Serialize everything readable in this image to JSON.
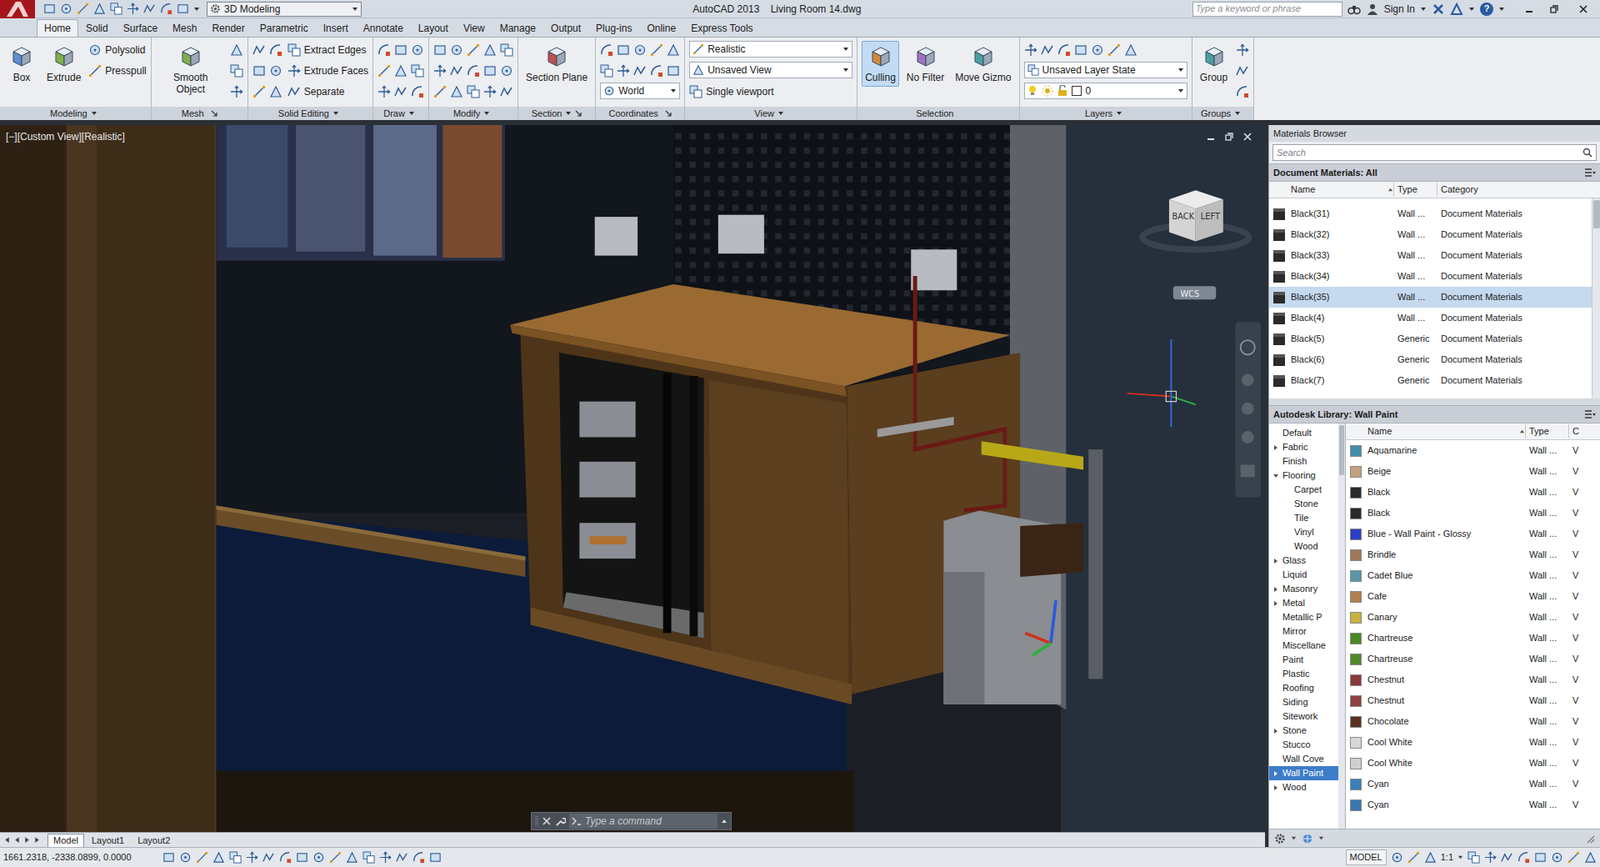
{
  "title_bar": {
    "workspace": "3D Modeling",
    "title": "AutoCAD 2013    Living Room 14.dwg",
    "search_placeholder": "Type a keyword or phrase",
    "sign_in": "Sign In",
    "help": "?"
  },
  "ribbon": {
    "tabs": [
      {
        "label": "Home",
        "selected": true
      },
      {
        "label": "Solid",
        "selected": false
      },
      {
        "label": "Surface",
        "selected": false
      },
      {
        "label": "Mesh",
        "selected": false
      },
      {
        "label": "Render",
        "selected": false
      },
      {
        "label": "Parametric",
        "selected": false
      },
      {
        "label": "Insert",
        "selected": false
      },
      {
        "label": "Annotate",
        "selected": false
      },
      {
        "label": "Layout",
        "selected": false
      },
      {
        "label": "View",
        "selected": false
      },
      {
        "label": "Manage",
        "selected": false
      },
      {
        "label": "Output",
        "selected": false
      },
      {
        "label": "Plug-ins",
        "selected": false
      },
      {
        "label": "Online",
        "selected": false
      },
      {
        "label": "Express Tools",
        "selected": false
      }
    ],
    "panels": [
      {
        "title": "Modeling",
        "menu": true,
        "launcher": false,
        "tools": [
          {
            "kind": "large",
            "label": "Box"
          },
          {
            "kind": "large",
            "label": "Extrude"
          },
          {
            "kind": "small",
            "label": "Polysolid"
          },
          {
            "kind": "small",
            "label": "Presspull"
          }
        ]
      },
      {
        "title": "Mesh",
        "menu": false,
        "launcher": true,
        "tools": [
          {
            "kind": "large",
            "label": "Smooth Object"
          },
          {
            "kind": "strip",
            "icons": 1
          },
          {
            "kind": "strip",
            "icons": 1
          },
          {
            "kind": "strip",
            "icons": 1
          }
        ]
      },
      {
        "title": "Solid Editing",
        "menu": true,
        "launcher": false,
        "tools": [
          {
            "kind": "strip",
            "icons": 2
          },
          {
            "kind": "strip",
            "icons": 2
          },
          {
            "kind": "strip",
            "icons": 2
          },
          {
            "kind": "small",
            "label": "Extract Edges"
          },
          {
            "kind": "small",
            "label": "Extrude Faces"
          },
          {
            "kind": "small",
            "label": "Separate"
          }
        ]
      },
      {
        "title": "Draw",
        "menu": true,
        "launcher": false,
        "tools": [
          {
            "kind": "strip",
            "icons": 3
          },
          {
            "kind": "strip",
            "icons": 3
          },
          {
            "kind": "strip",
            "icons": 3
          }
        ]
      },
      {
        "title": "Modify",
        "menu": true,
        "launcher": false,
        "tools": [
          {
            "kind": "strip",
            "icons": 5
          },
          {
            "kind": "strip",
            "icons": 5
          },
          {
            "kind": "strip",
            "icons": 5
          }
        ]
      },
      {
        "title": "Section",
        "menu": true,
        "launcher": true,
        "tools": [
          {
            "kind": "large",
            "label": "Section Plane"
          }
        ]
      },
      {
        "title": "Coordinates",
        "menu": false,
        "launcher": true,
        "tools": [
          {
            "kind": "strip",
            "icons": 5
          },
          {
            "kind": "strip",
            "icons": 5
          },
          {
            "kind": "dropdown",
            "label": "World"
          }
        ]
      },
      {
        "title": "View",
        "menu": true,
        "launcher": false,
        "tools": [
          {
            "kind": "dropdown",
            "label": "Realistic"
          },
          {
            "kind": "dropdown",
            "label": "Unsaved View"
          },
          {
            "kind": "small",
            "label": "Single viewport"
          }
        ]
      },
      {
        "title": "Selection",
        "menu": false,
        "launcher": false,
        "tools": [
          {
            "kind": "toggle",
            "label": "Culling",
            "on": true
          },
          {
            "kind": "large",
            "label": "No Filter"
          },
          {
            "kind": "large",
            "label": "Move Gizmo"
          }
        ]
      },
      {
        "title": "Layers",
        "menu": true,
        "launcher": false,
        "tools": [
          {
            "kind": "strip",
            "icons": 7
          },
          {
            "kind": "dropdown",
            "label": "Unsaved Layer State"
          },
          {
            "kind": "layer",
            "label": "0"
          }
        ]
      },
      {
        "title": "Groups",
        "menu": true,
        "launcher": false,
        "tools": [
          {
            "kind": "large",
            "label": "Group"
          },
          {
            "kind": "strip",
            "icons": 1
          },
          {
            "kind": "strip",
            "icons": 1
          },
          {
            "kind": "strip",
            "icons": 1
          }
        ]
      }
    ]
  },
  "viewport": {
    "label": "[−][Custom View][Realistic]",
    "viewcube": {
      "back": "BACK",
      "left": "LEFT",
      "wcs": "WCS"
    },
    "command_placeholder": "Type a command"
  },
  "layout_tabs": [
    {
      "label": "Model",
      "selected": true
    },
    {
      "label": "Layout1",
      "selected": false
    },
    {
      "label": "Layout2",
      "selected": false
    }
  ],
  "status_bar": {
    "coordinates": "1661.2318, -2338.0899, 0.0000",
    "space": "MODEL",
    "scale": "1:1"
  },
  "materials_browser": {
    "title": "Materials Browser",
    "search_placeholder": "Search",
    "doc_header": "Document Materials: All",
    "doc_columns": [
      "Name",
      "Type",
      "Category"
    ],
    "doc_rows": [
      {
        "name": "Black(31)",
        "type": "Wall ...",
        "category": "Document Materials",
        "selected": false
      },
      {
        "name": "Black(32)",
        "type": "Wall ...",
        "category": "Document Materials",
        "selected": false
      },
      {
        "name": "Black(33)",
        "type": "Wall ...",
        "category": "Document Materials",
        "selected": false
      },
      {
        "name": "Black(34)",
        "type": "Wall ...",
        "category": "Document Materials",
        "selected": false
      },
      {
        "name": "Black(35)",
        "type": "Wall ...",
        "category": "Document Materials",
        "selected": true
      },
      {
        "name": "Black(4)",
        "type": "Wall ...",
        "category": "Document Materials",
        "selected": false
      },
      {
        "name": "Black(5)",
        "type": "Generic",
        "category": "Document Materials",
        "selected": false
      },
      {
        "name": "Black(6)",
        "type": "Generic",
        "category": "Document Materials",
        "selected": false
      },
      {
        "name": "Black(7)",
        "type": "Generic",
        "category": "Document Materials",
        "selected": false
      }
    ],
    "library_header": "Autodesk Library: Wall Paint",
    "tree": [
      {
        "label": "Default",
        "expander": "none",
        "depth": 0,
        "selected": false
      },
      {
        "label": "Fabric",
        "expander": "collapsed",
        "depth": 0,
        "selected": false
      },
      {
        "label": "Finish",
        "expander": "none",
        "depth": 0,
        "selected": false
      },
      {
        "label": "Flooring",
        "expander": "expanded",
        "depth": 0,
        "selected": false
      },
      {
        "label": "Carpet",
        "expander": "none",
        "depth": 1,
        "selected": false
      },
      {
        "label": "Stone",
        "expander": "none",
        "depth": 1,
        "selected": false
      },
      {
        "label": "Tile",
        "expander": "none",
        "depth": 1,
        "selected": false
      },
      {
        "label": "Vinyl",
        "expander": "none",
        "depth": 1,
        "selected": false
      },
      {
        "label": "Wood",
        "expander": "none",
        "depth": 1,
        "selected": false
      },
      {
        "label": "Glass",
        "expander": "collapsed",
        "depth": 0,
        "selected": false
      },
      {
        "label": "Liquid",
        "expander": "none",
        "depth": 0,
        "selected": false
      },
      {
        "label": "Masonry",
        "expander": "collapsed",
        "depth": 0,
        "selected": false
      },
      {
        "label": "Metal",
        "expander": "collapsed",
        "depth": 0,
        "selected": false
      },
      {
        "label": "Metallic P",
        "expander": "none",
        "depth": 0,
        "selected": false
      },
      {
        "label": "Mirror",
        "expander": "none",
        "depth": 0,
        "selected": false
      },
      {
        "label": "Miscellane",
        "expander": "none",
        "depth": 0,
        "selected": false
      },
      {
        "label": "Paint",
        "expander": "none",
        "depth": 0,
        "selected": false
      },
      {
        "label": "Plastic",
        "expander": "none",
        "depth": 0,
        "selected": false
      },
      {
        "label": "Roofing",
        "expander": "none",
        "depth": 0,
        "selected": false
      },
      {
        "label": "Siding",
        "expander": "none",
        "depth": 0,
        "selected": false
      },
      {
        "label": "Sitework",
        "expander": "none",
        "depth": 0,
        "selected": false
      },
      {
        "label": "Stone",
        "expander": "collapsed",
        "depth": 0,
        "selected": false
      },
      {
        "label": "Stucco",
        "expander": "none",
        "depth": 0,
        "selected": false
      },
      {
        "label": "Wall Cove",
        "expander": "none",
        "depth": 0,
        "selected": false
      },
      {
        "label": "Wall Paint",
        "expander": "collapsed",
        "depth": 0,
        "selected": true
      },
      {
        "label": "Wood",
        "expander": "collapsed",
        "depth": 0,
        "selected": false
      }
    ],
    "library_columns": [
      "Name",
      "Type",
      "C"
    ],
    "library_rows": [
      {
        "name": "Aquamarine",
        "type": "Wall ...",
        "c": "V",
        "color": "#3f8fa8"
      },
      {
        "name": "Beige",
        "type": "Wall ...",
        "c": "V",
        "color": "#c4a080"
      },
      {
        "name": "Black",
        "type": "Wall ...",
        "c": "V",
        "color": "#2a2a2a"
      },
      {
        "name": "Black",
        "type": "Wall ...",
        "c": "V",
        "color": "#2a2a2a"
      },
      {
        "name": "Blue - Wall Paint - Glossy",
        "type": "Wall ...",
        "c": "V",
        "color": "#2a3fc8"
      },
      {
        "name": "Brindle",
        "type": "Wall ...",
        "c": "V",
        "color": "#a07858"
      },
      {
        "name": "Cadet Blue",
        "type": "Wall ...",
        "c": "V",
        "color": "#5b95a8"
      },
      {
        "name": "Cafe",
        "type": "Wall ...",
        "c": "V",
        "color": "#b08050"
      },
      {
        "name": "Canary",
        "type": "Wall ...",
        "c": "V",
        "color": "#c8b040"
      },
      {
        "name": "Chartreuse",
        "type": "Wall ...",
        "c": "V",
        "color": "#4a8a20"
      },
      {
        "name": "Chartreuse",
        "type": "Wall ...",
        "c": "V",
        "color": "#508828"
      },
      {
        "name": "Chestnut",
        "type": "Wall ...",
        "c": "V",
        "color": "#8a3a3a"
      },
      {
        "name": "Chestnut",
        "type": "Wall ...",
        "c": "V",
        "color": "#904040"
      },
      {
        "name": "Chocolate",
        "type": "Wall ...",
        "c": "V",
        "color": "#5a3020"
      },
      {
        "name": "Cool White",
        "type": "Wall ...",
        "c": "V",
        "color": "#d8d8d8"
      },
      {
        "name": "Cool White",
        "type": "Wall ...",
        "c": "V",
        "color": "#d0d0d0"
      },
      {
        "name": "Cyan",
        "type": "Wall ...",
        "c": "V",
        "color": "#3a80b8"
      },
      {
        "name": "Cyan",
        "type": "Wall ...",
        "c": "V",
        "color": "#3a78b0"
      }
    ]
  }
}
